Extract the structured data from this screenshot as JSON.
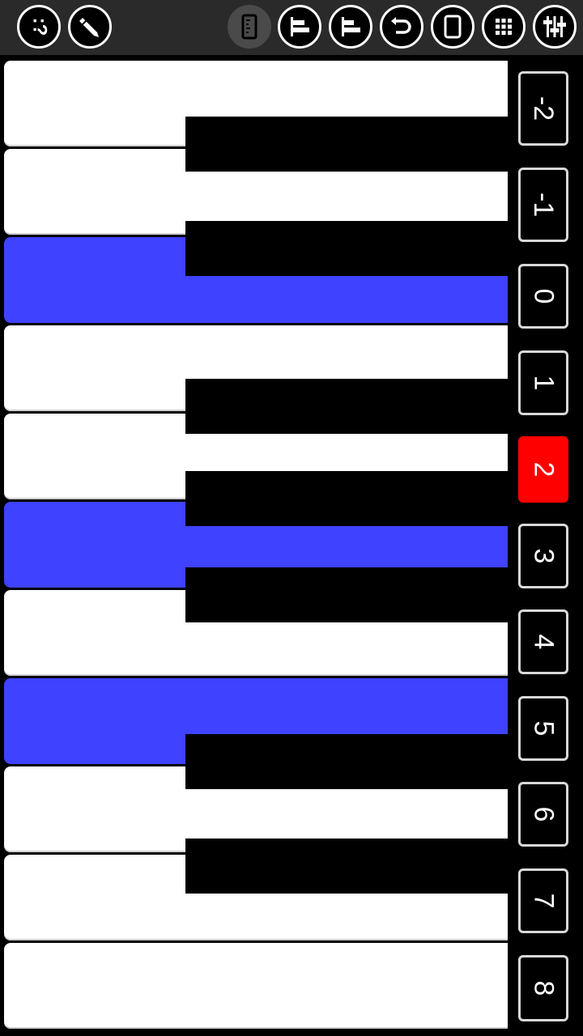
{
  "toolbar": {
    "buttons": [
      {
        "icon": "help-icon",
        "label": ":?"
      },
      {
        "icon": "pencil-icon"
      },
      {
        "icon": "ruler-icon",
        "active": true
      },
      {
        "icon": "align-left-bars-icon"
      },
      {
        "icon": "align-left-bars-small-icon"
      },
      {
        "icon": "undo-icon"
      },
      {
        "icon": "tablet-rotate-icon"
      },
      {
        "icon": "grid-icon"
      },
      {
        "icon": "mixer-sliders-icon"
      }
    ]
  },
  "keyboard": {
    "highlight_color": "#3f42ff",
    "white_keys_lit": [
      false,
      false,
      true,
      false,
      false,
      true,
      false,
      true,
      false,
      false,
      false
    ],
    "black_keys_lit": [
      false,
      false,
      false,
      false,
      true,
      false,
      false,
      false
    ]
  },
  "octaves": {
    "labels": [
      "-2",
      "-1",
      "0",
      "1",
      "2",
      "3",
      "4",
      "5",
      "6",
      "7",
      "8"
    ],
    "selected": "2",
    "selected_color": "#ff0000"
  }
}
